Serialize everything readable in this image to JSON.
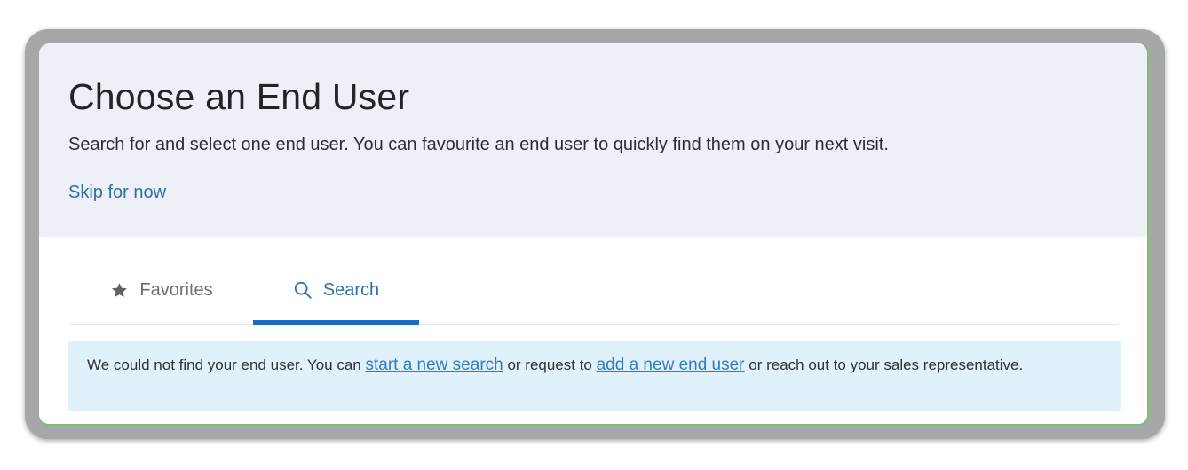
{
  "header": {
    "title": "Choose an End User",
    "subtitle": "Search for and select one end user. You can favourite an end user to quickly find them on your next visit.",
    "skip_link": "Skip for now"
  },
  "tabs": [
    {
      "label": "Favorites",
      "icon": "star-icon",
      "active": false
    },
    {
      "label": "Search",
      "icon": "search-icon",
      "active": true
    }
  ],
  "notice": {
    "text_before": "We could not find your end user. You can ",
    "link_new_search": "start a new search",
    "text_middle": " or request to ",
    "link_add_user": "add a new end user",
    "text_after": " or reach out to your sales representative."
  },
  "colors": {
    "header_bg": "#edf0f6",
    "link": "#2f6fa8",
    "active_tab_underline": "#1a6bc2",
    "notice_bg": "#dff1fb"
  }
}
